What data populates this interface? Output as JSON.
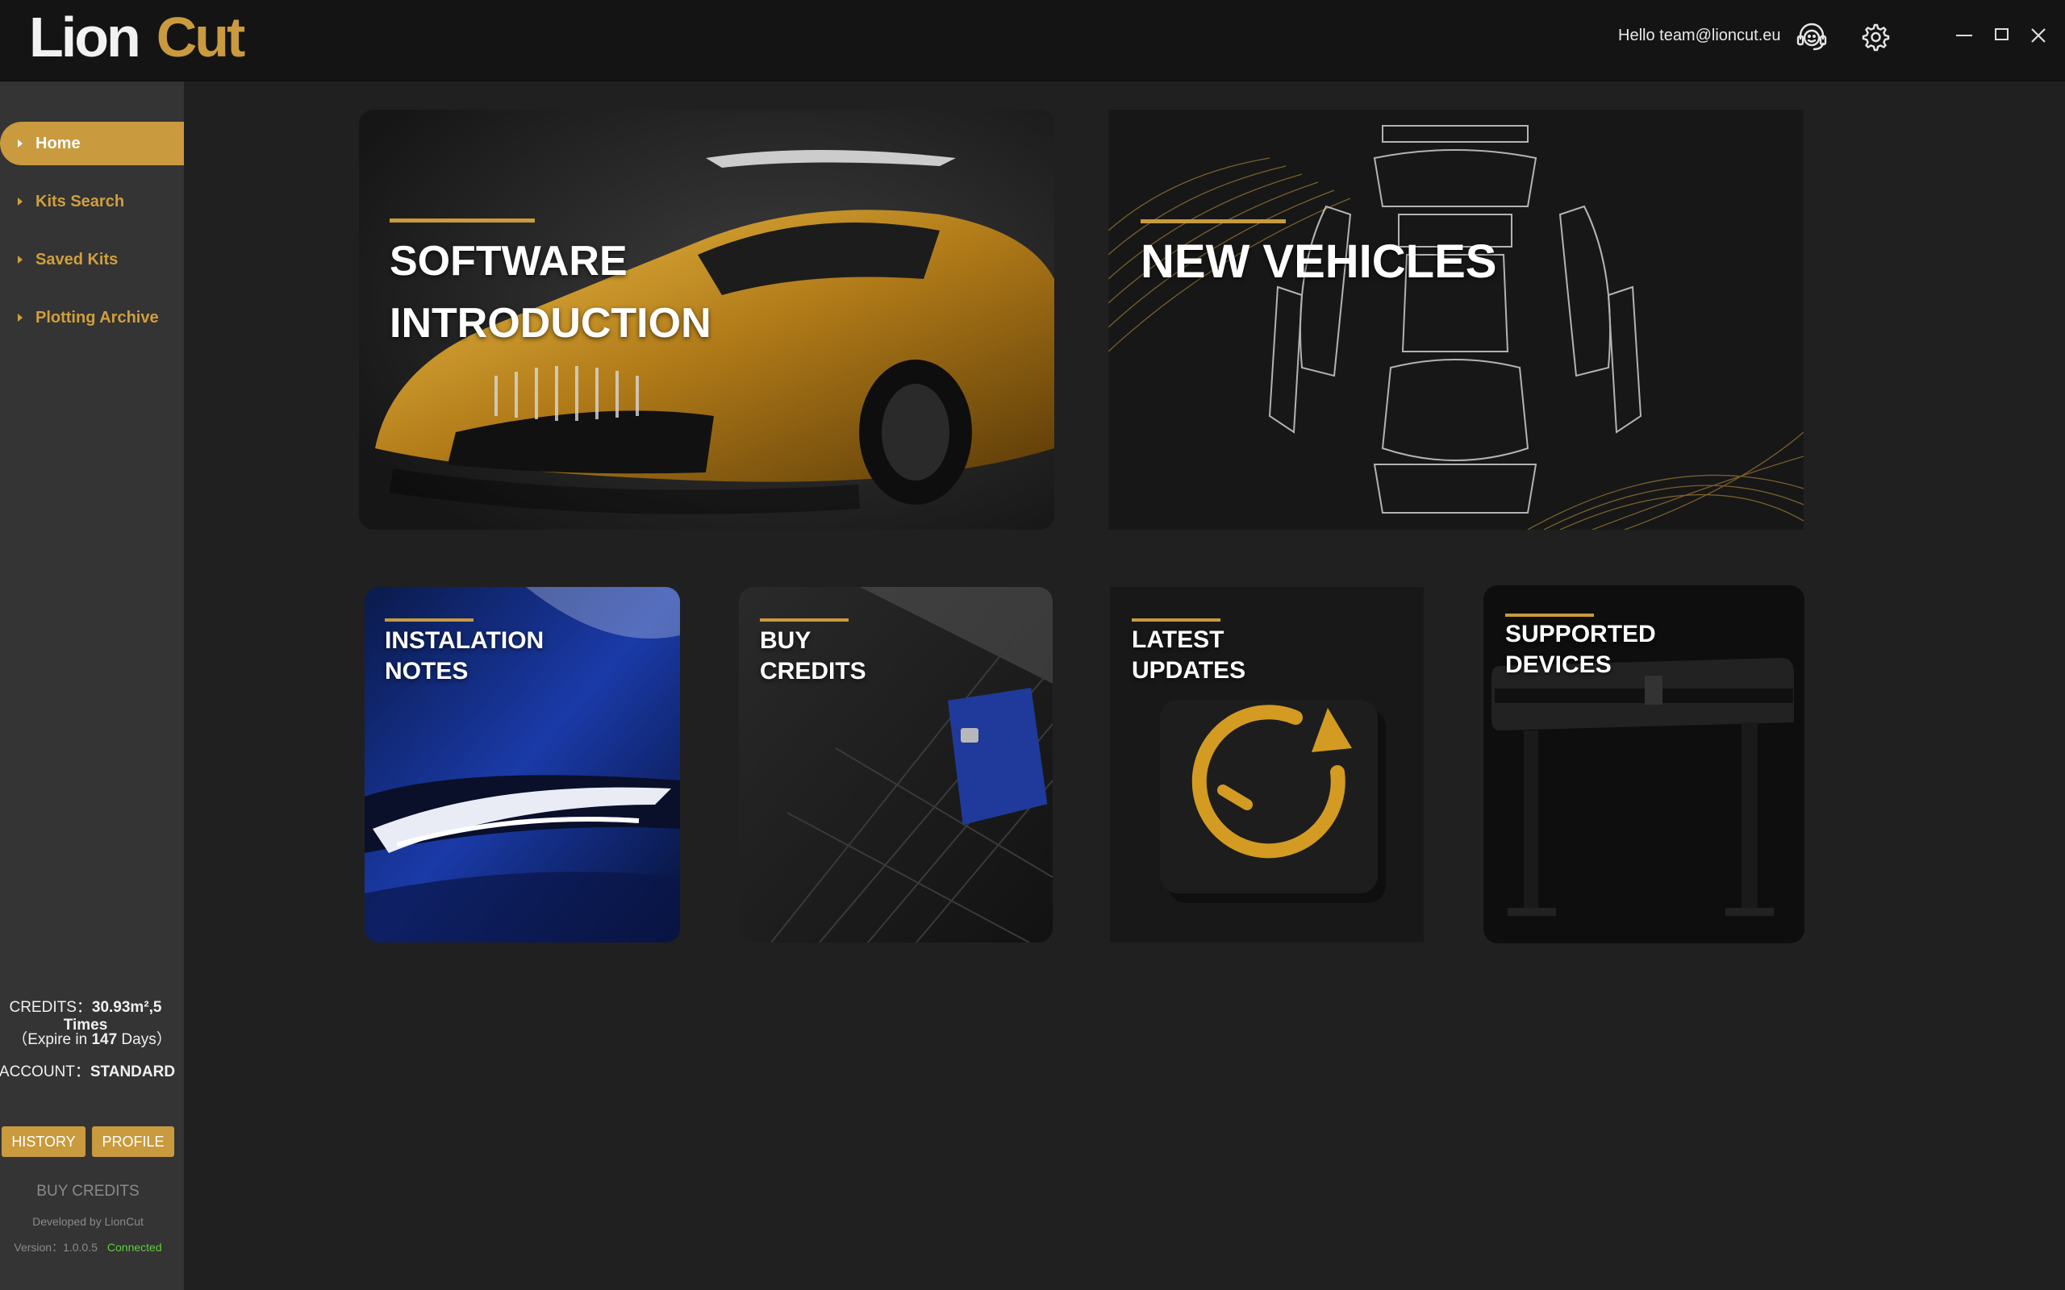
{
  "header": {
    "logo": {
      "part1": "Lion",
      "part2": "Cut"
    },
    "greeting": "Hello team@lioncut.eu",
    "icons": [
      "support-headset-icon",
      "settings-gear-icon"
    ],
    "window": [
      "minimize-icon",
      "maximize-icon",
      "close-icon"
    ]
  },
  "sidebar": {
    "items": [
      {
        "label": "Home",
        "active": true
      },
      {
        "label": "Kits Search",
        "active": false
      },
      {
        "label": "Saved Kits",
        "active": false
      },
      {
        "label": "Plotting Archive",
        "active": false
      }
    ],
    "credits": {
      "prefix": "CREDITS：",
      "value": "30.93m²,5 Times",
      "expire_prefix": "（Expire in ",
      "expire_days": "147",
      "expire_suffix": " Days）",
      "account_prefix": "ACCOUNT：",
      "account_type": "STANDARD"
    },
    "buttons": {
      "history": "HISTORY",
      "profile": "PROFILE"
    },
    "buy_credits": "BUY CREDITS",
    "developed_by": "Developed by LionCut",
    "version": "Version：1.0.0.5",
    "status": "Connected"
  },
  "cards": {
    "software": {
      "line1": "SOFTWARE",
      "line2": "INTRODUCTION"
    },
    "vehicles": {
      "line1": "NEW VEHICLES"
    },
    "installation": {
      "line1": "INSTALATION",
      "line2": "NOTES"
    },
    "buy": {
      "line1": "BUY",
      "line2": "CREDITS"
    },
    "updates": {
      "line1": "LATEST",
      "line2": "UPDATES"
    },
    "devices": {
      "line1": "SUPPORTED",
      "line2": "DEVICES"
    }
  },
  "colors": {
    "accent": "#c99a3e",
    "background": "#202020",
    "sidebar": "#343434",
    "titlebar": "#141414",
    "connected": "#5fcf3a"
  }
}
